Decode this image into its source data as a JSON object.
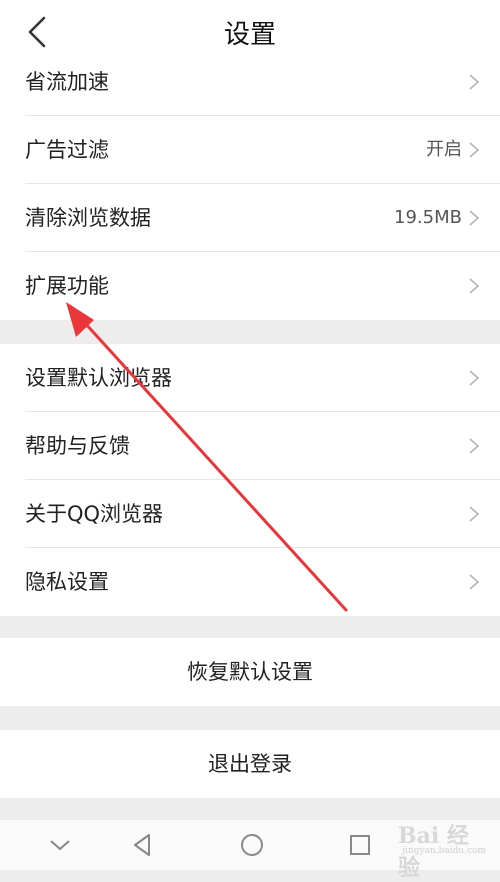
{
  "header": {
    "title": "设置",
    "back_icon": "back-chevron-icon"
  },
  "group1": [
    {
      "label": "省流加速",
      "value": ""
    },
    {
      "label": "广告过滤",
      "value": "开启"
    },
    {
      "label": "清除浏览数据",
      "value": "19.5MB"
    },
    {
      "label": "扩展功能",
      "value": ""
    }
  ],
  "group2": [
    {
      "label": "设置默认浏览器"
    },
    {
      "label": "帮助与反馈"
    },
    {
      "label": "关于QQ浏览器"
    },
    {
      "label": "隐私设置"
    }
  ],
  "actions": {
    "restore": "恢复默认设置",
    "logout": "退出登录"
  },
  "watermark": {
    "brand": "Bai 经验",
    "url": "jingyan.baidu.com"
  },
  "colors": {
    "annotation_arrow": "#e8363b",
    "background": "#ededed"
  }
}
